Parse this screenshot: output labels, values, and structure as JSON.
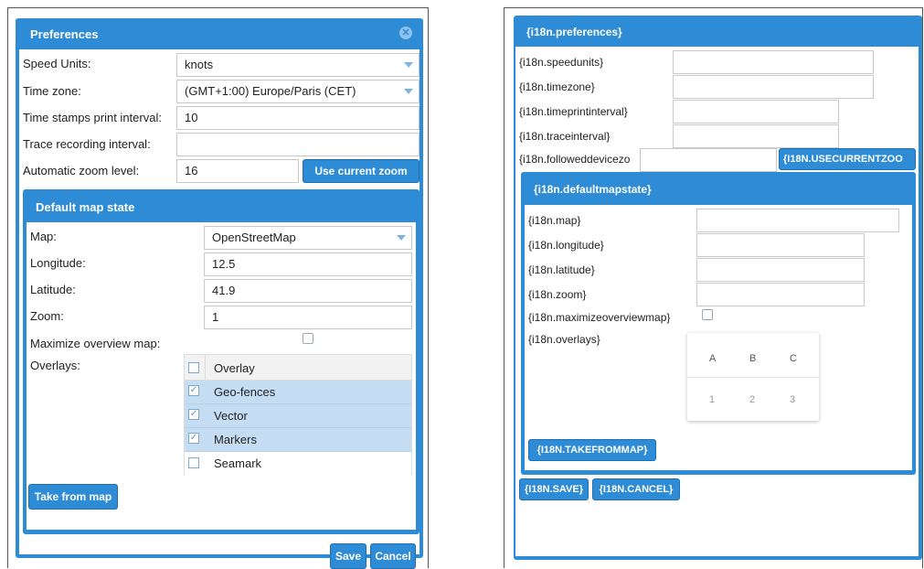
{
  "left": {
    "title": "Preferences",
    "speed_units_label": "Speed Units:",
    "speed_units_value": "knots",
    "timezone_label": "Time zone:",
    "timezone_value": "(GMT+1:00) Europe/Paris (CET)",
    "timestamps_label": "Time stamps print interval:",
    "timestamps_value": "10",
    "trace_label": "Trace recording interval:",
    "trace_value": "",
    "zoom_level_label": "Automatic zoom level:",
    "zoom_level_value": "16",
    "use_current_zoom": "Use current zoom",
    "default_map_state": {
      "title": "Default map state",
      "map_label": "Map:",
      "map_value": "OpenStreetMap",
      "longitude_label": "Longitude:",
      "longitude_value": "12.5",
      "latitude_label": "Latitude:",
      "latitude_value": "41.9",
      "zoom_label": "Zoom:",
      "zoom_value": "1",
      "maximize_label": "Maximize overview map:",
      "overlays_label": "Overlays:",
      "overlay_header": "Overlay",
      "overlays": [
        {
          "name": "Geo-fences",
          "checked": true
        },
        {
          "name": "Vector",
          "checked": true
        },
        {
          "name": "Markers",
          "checked": true
        },
        {
          "name": "Seamark",
          "checked": false
        }
      ],
      "take_from_map": "Take from map"
    },
    "save": "Save",
    "cancel": "Cancel"
  },
  "right": {
    "title": "{i18n.preferences}",
    "speedunits": "{i18n.speedunits}",
    "timezone": "{i18n.timezone}",
    "timeprintinterval": "{i18n.timeprintinterval}",
    "traceinterval": "{i18n.traceinterval}",
    "followeddevicezoom": "{i18n.followeddevicezo",
    "usecurrentzoom": "{I18N.USECURRENTZOO",
    "default_map_state": {
      "title": "{i18n.defaultmapstate}",
      "map": "{i18n.map}",
      "longitude": "{i18n.longitude}",
      "latitude": "{i18n.latitude}",
      "zoom": "{i18n.zoom}",
      "maximize": "{i18n.maximizeoverviewmap}",
      "overlays": "{i18n.overlays}",
      "grid_headers": [
        "A",
        "B",
        "C"
      ],
      "grid_values": [
        "1",
        "2",
        "3"
      ],
      "take_from_map": "{I18N.TAKEFROMMAP}"
    },
    "save": "{I18N.SAVE}",
    "cancel": "{I18N.CANCEL}"
  },
  "colors": {
    "accent": "#2e8bd6",
    "selected_row": "#c5ddf2"
  }
}
